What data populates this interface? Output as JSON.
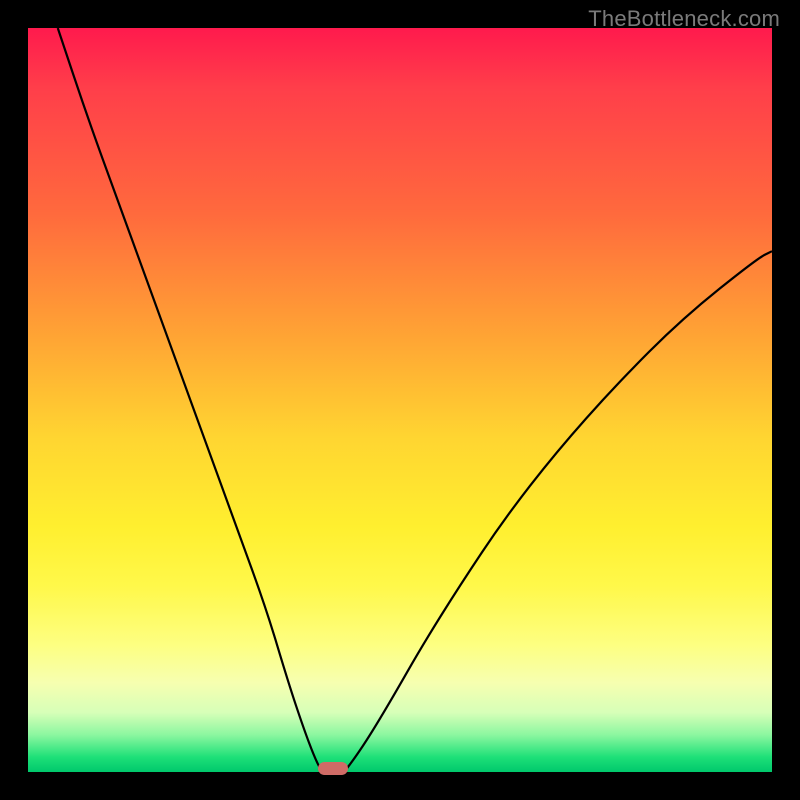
{
  "attribution": "TheBottleneck.com",
  "chart_data": {
    "type": "line",
    "title": "",
    "xlabel": "",
    "ylabel": "",
    "xlim": [
      0,
      100
    ],
    "ylim": [
      0,
      100
    ],
    "series": [
      {
        "name": "left-curve",
        "x": [
          4,
          8,
          12,
          16,
          20,
          24,
          28,
          32,
          35,
          37,
          38.5,
          39.5
        ],
        "y": [
          100,
          88,
          77,
          66,
          55,
          44,
          33,
          22,
          12,
          6,
          2,
          0
        ]
      },
      {
        "name": "right-curve",
        "x": [
          42.5,
          44,
          46,
          49,
          53,
          58,
          64,
          71,
          79,
          88,
          98,
          100
        ],
        "y": [
          0,
          2,
          5,
          10,
          17,
          25,
          34,
          43,
          52,
          61,
          69,
          70
        ]
      }
    ],
    "marker": {
      "x_center": 41,
      "width": 4,
      "y": 0,
      "color": "#cf6b66"
    },
    "gradient_bands": [
      {
        "at_y_percent": 0,
        "color": "#ff1a4d"
      },
      {
        "at_y_percent": 25,
        "color": "#ff6a3d"
      },
      {
        "at_y_percent": 55,
        "color": "#ffd531"
      },
      {
        "at_y_percent": 83,
        "color": "#fdff82"
      },
      {
        "at_y_percent": 100,
        "color": "#00c86c"
      }
    ]
  }
}
